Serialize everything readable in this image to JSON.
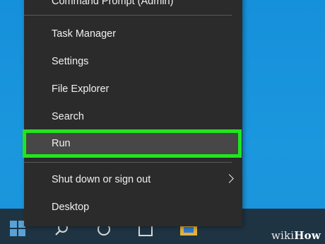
{
  "desktop": {
    "background_color": "#1a94dc"
  },
  "taskbar": {
    "icons": [
      "windows-logo-icon",
      "search-icon",
      "task-view-icon",
      "edge-icon",
      "file-explorer-icon"
    ]
  },
  "menu": {
    "items": [
      {
        "label": "Command Prompt (Admin)"
      },
      {
        "label": "Task Manager"
      },
      {
        "label": "Settings"
      },
      {
        "label": "File Explorer"
      },
      {
        "label": "Search"
      },
      {
        "label": "Run"
      },
      {
        "label": "Shut down or sign out",
        "submenu": true
      },
      {
        "label": "Desktop"
      }
    ],
    "highlighted_item": "Run",
    "highlight_color": "#22e51e"
  },
  "watermark": {
    "part1": "wiki",
    "part2": "How"
  }
}
